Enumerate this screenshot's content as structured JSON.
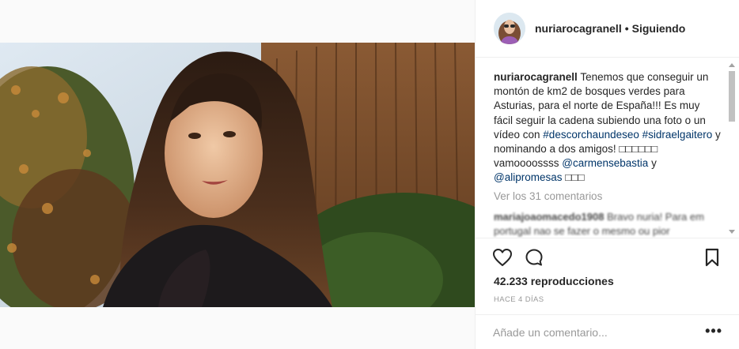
{
  "post": {
    "username": "nuriarocagranell",
    "follow_status": "Siguiendo",
    "separator": "•"
  },
  "caption": {
    "user": "nuriarocagranell",
    "text_1": "Tenemos que conseguir un montón de km2 de bosques verdes para Asturias, para el norte de España!!! Es muy fácil seguir la cadena subiendo una foto o un vídeo con ",
    "hashtag_1": "#descorchaundeseo",
    "hashtag_2": "#sidraelgaitero",
    "text_2": " y nominando a dos amigos! □□□□□□ vamoooossss ",
    "mention_1": "@carmensebastia",
    "text_3": " y ",
    "mention_2": "@alipromesas",
    "text_4": " □□□"
  },
  "comments": {
    "view_all": "Ver los 31 comentarios",
    "first": {
      "user": "mariajoaomacedo1908",
      "text": "Bravo nuria! Para em portugal nao se fazer o mesmo ou pior"
    }
  },
  "stats": {
    "views": "42.233 reproducciones",
    "time_ago": "HACE 4 DÍAS"
  },
  "comment_box": {
    "placeholder": "Añade un comentario...",
    "more": "•••"
  },
  "icons": {
    "like": "heart-icon",
    "comment": "comment-icon",
    "save": "bookmark-icon",
    "more": "more-options-icon"
  },
  "colors": {
    "text": "#262626",
    "muted": "#999999",
    "link": "#003569",
    "border": "#efefef"
  }
}
